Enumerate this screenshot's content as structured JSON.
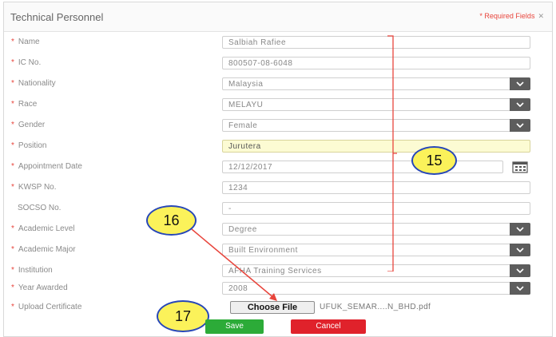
{
  "panel": {
    "title": "Technical Personnel",
    "required_note": "* Required Fields",
    "close_glyph": "✕"
  },
  "fields": [
    {
      "label": "Name",
      "required": true,
      "value": "Salbiah Rafiee",
      "type": "text"
    },
    {
      "label": "IC No.",
      "required": true,
      "value": "800507-08-6048",
      "type": "text"
    },
    {
      "label": "Nationality",
      "required": true,
      "value": "Malaysia",
      "type": "select"
    },
    {
      "label": "Race",
      "required": true,
      "value": "MELAYU",
      "type": "select"
    },
    {
      "label": "Gender",
      "required": true,
      "value": "Female",
      "type": "select"
    },
    {
      "label": "Position",
      "required": true,
      "value": "Jurutera",
      "type": "text",
      "highlighted": true
    },
    {
      "label": "Appointment Date",
      "required": true,
      "value": "12/12/2017",
      "type": "date"
    },
    {
      "label": "KWSP No.",
      "required": true,
      "value": "1234",
      "type": "text"
    },
    {
      "label": "SOCSO No.",
      "required": false,
      "value": "-",
      "type": "text"
    },
    {
      "label": "Academic Level",
      "required": true,
      "value": "Degree",
      "type": "select"
    },
    {
      "label": "Academic Major",
      "required": true,
      "value": "Built Environment",
      "type": "select"
    },
    {
      "label": "Institution",
      "required": true,
      "value": "AFHA Training Services",
      "type": "select"
    },
    {
      "label": "Year Awarded",
      "required": true,
      "value": "2008",
      "type": "select"
    }
  ],
  "upload": {
    "label": "Upload Certificate",
    "button_label": "Choose File",
    "filename": "UFUK_SEMAR....N_BHD.pdf"
  },
  "actions": {
    "save_label": "Save",
    "cancel_label": "Cancel"
  },
  "annotations": {
    "callout_15": "15",
    "callout_16": "16",
    "callout_17": "17",
    "callout_fill": "#fbf25a",
    "callout_border": "#2747b8",
    "arrow_color": "#e8453c"
  },
  "icons": {
    "dropdown": "chevron-down-icon",
    "calendar": "calendar-icon",
    "close": "close-icon"
  }
}
